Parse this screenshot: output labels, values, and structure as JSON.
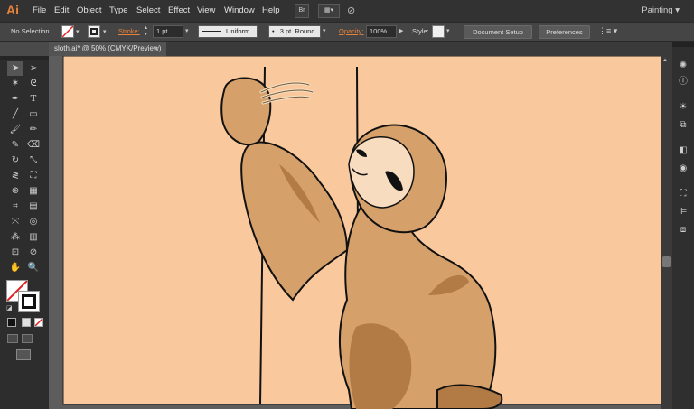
{
  "app": {
    "logo": "Ai",
    "workspace": "Painting"
  },
  "menu": [
    "File",
    "Edit",
    "Object",
    "Type",
    "Select",
    "Effect",
    "View",
    "Window",
    "Help"
  ],
  "menu_buttons": {
    "bridge": "Br"
  },
  "control": {
    "selection": "No Selection",
    "stroke_label": "Stroke:",
    "stroke_value": "1 pt",
    "profile": "Uniform",
    "brush": "3 pt. Round",
    "opacity_label": "Opacity:",
    "opacity_value": "100%",
    "style_label": "Style:",
    "document_setup": "Document Setup",
    "preferences": "Preferences"
  },
  "document_tab": {
    "title": "sloth.ai* @ 50% (CMYK/Preview)",
    "close": "×"
  },
  "colors": {
    "artboard": "#f9c99d",
    "fur": "#d6a06a",
    "fur_shadow": "#b27a44",
    "face": "#f8dcc0",
    "accent": "#e8833a"
  },
  "icons": {
    "tools": [
      "selection-icon",
      "direct-selection-icon",
      "magic-wand-icon",
      "lasso-icon",
      "pen-icon",
      "type-icon",
      "line-segment-icon",
      "rectangle-icon",
      "paintbrush-icon",
      "pencil-icon",
      "blob-brush-icon",
      "eraser-icon",
      "rotate-icon",
      "scale-icon",
      "width-icon",
      "free-transform-icon",
      "shape-builder-icon",
      "perspective-grid-icon",
      "mesh-icon",
      "gradient-icon",
      "eyedropper-icon",
      "blend-icon",
      "symbol-sprayer-icon",
      "column-graph-icon",
      "artboard-icon",
      "slice-icon",
      "hand-icon",
      "zoom-icon"
    ],
    "dock": [
      "color-guide-icon",
      "info-icon",
      "appearance-icon",
      "artboards-icon",
      "transparency-icon",
      "layers-icon",
      "transform-icon",
      "align-icon",
      "pathfinder-icon"
    ]
  }
}
